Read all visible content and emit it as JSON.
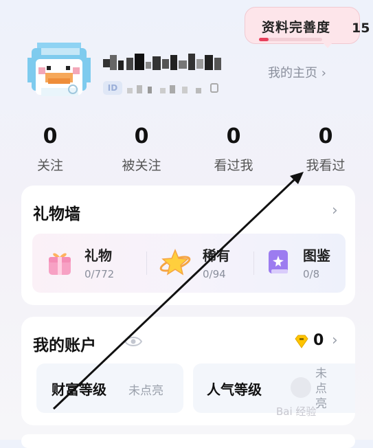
{
  "profile": {
    "completion_label": "资料完善度",
    "completion_percent_text": "15",
    "completion_fill": 0.15,
    "id_badge": "ID",
    "homepage_link": "我的主页 ›"
  },
  "stats": [
    {
      "value": "0",
      "label": "关注"
    },
    {
      "value": "0",
      "label": "被关注"
    },
    {
      "value": "0",
      "label": "看过我"
    },
    {
      "value": "0",
      "label": "我看过"
    }
  ],
  "gift_wall": {
    "title": "礼物墙",
    "chevron": "›",
    "items": [
      {
        "name": "礼物",
        "count": "0/772",
        "icon": "gift-box-icon"
      },
      {
        "name": "稀有",
        "count": "0/94",
        "icon": "star-planet-icon"
      },
      {
        "name": "图鉴",
        "count": "0/8",
        "icon": "book-icon"
      }
    ]
  },
  "account": {
    "title": "我的账户",
    "eye_icon": "eye-icon",
    "coin_icon": "diamond-coin-icon",
    "balance": "0",
    "chevron": "›",
    "levels": [
      {
        "name": "财富等级",
        "status": "未点亮"
      },
      {
        "name": "人气等级",
        "status": "未点亮"
      }
    ]
  },
  "watermark": "Bai 经验",
  "colors": {
    "accent": "#e8405c",
    "bubble_bg": "#fde5ea",
    "card_bg": "#ffffff",
    "muted_text": "#8a8f9c"
  }
}
